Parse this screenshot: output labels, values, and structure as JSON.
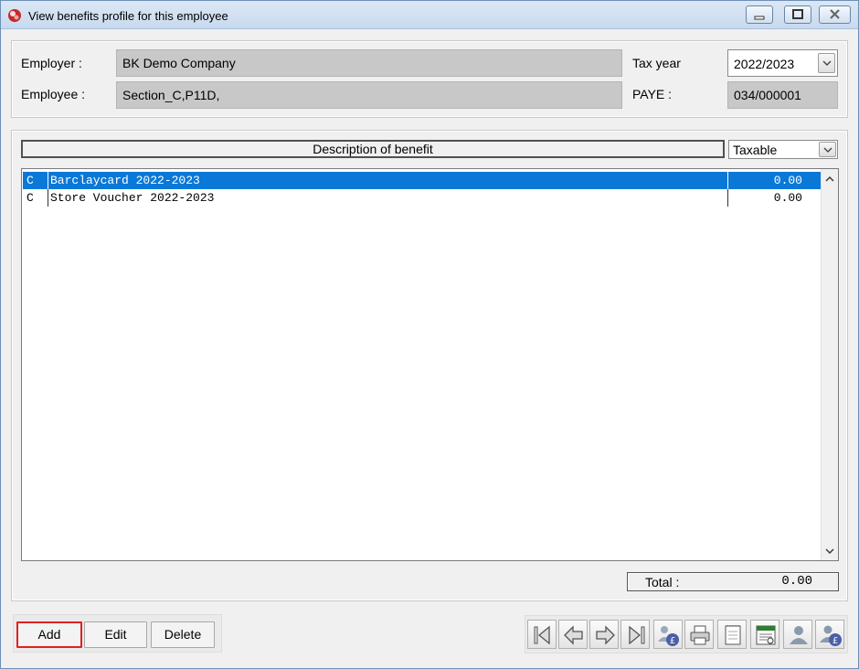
{
  "window": {
    "title": "View benefits profile for this employee"
  },
  "header": {
    "employer_label": "Employer :",
    "employer_value": "BK Demo Company",
    "employee_label": "Employee :",
    "employee_value": "Section_C,P11D,",
    "tax_year_label": "Tax year",
    "tax_year_value": "2022/2023",
    "paye_label": "PAYE :",
    "paye_value": "034/000001"
  },
  "list": {
    "column_header": "Description of benefit",
    "filter_value": "Taxable",
    "rows": [
      {
        "code": "C",
        "description": "Barclaycard 2022-2023",
        "amount": "0.00",
        "selected": true
      },
      {
        "code": "C",
        "description": "Store Voucher 2022-2023",
        "amount": "0.00",
        "selected": false
      }
    ]
  },
  "totals": {
    "label": "Total :",
    "value": "0.00"
  },
  "actions": {
    "add_label": "Add",
    "edit_label": "Edit",
    "delete_label": "Delete"
  },
  "toolbar_icons": [
    "first-record-icon",
    "previous-record-icon",
    "next-record-icon",
    "last-record-icon",
    "employee-pay-icon",
    "print-icon",
    "notes-icon",
    "report-view-icon",
    "employee-icon",
    "employee-pay-details-icon"
  ],
  "colors": {
    "selection": "#0a78d7",
    "highlight_border": "#e02020",
    "field_fill": "#c8c8c8"
  }
}
